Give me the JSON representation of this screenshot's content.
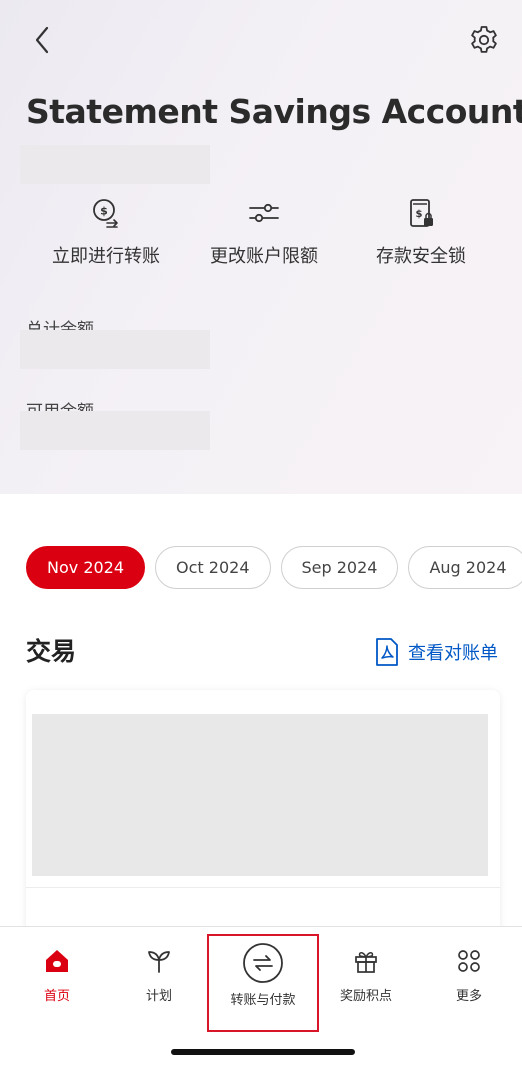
{
  "header": {
    "title": "Statement Savings Account",
    "back_icon": "chevron-left-icon",
    "settings_icon": "gear-icon"
  },
  "actions": [
    {
      "label": "立即进行转账",
      "icon": "transfer-money-icon"
    },
    {
      "label": "更改账户限额",
      "icon": "sliders-icon"
    },
    {
      "label": "存款安全锁",
      "icon": "deposit-lock-icon"
    }
  ],
  "balances": {
    "total_label": "总计余额",
    "available_label": "可用余额"
  },
  "months": [
    "Nov 2024",
    "Oct 2024",
    "Sep 2024",
    "Aug 2024"
  ],
  "selected_month": "Nov 2024",
  "transactions": {
    "title": "交易",
    "statement_link": "查看对账单"
  },
  "tabbar": {
    "items": [
      {
        "label": "首页",
        "icon": "home-icon",
        "active": true
      },
      {
        "label": "计划",
        "icon": "sprout-icon",
        "active": false
      },
      {
        "label": "转账与付款",
        "icon": "transfer-arrows-icon",
        "active": false
      },
      {
        "label": "奖励积点",
        "icon": "gift-icon",
        "active": false
      },
      {
        "label": "更多",
        "icon": "grid-dots-icon",
        "active": false
      }
    ]
  },
  "colors": {
    "accent": "#db0011",
    "link": "#0058c6",
    "highlight_box": "#d9152a"
  }
}
